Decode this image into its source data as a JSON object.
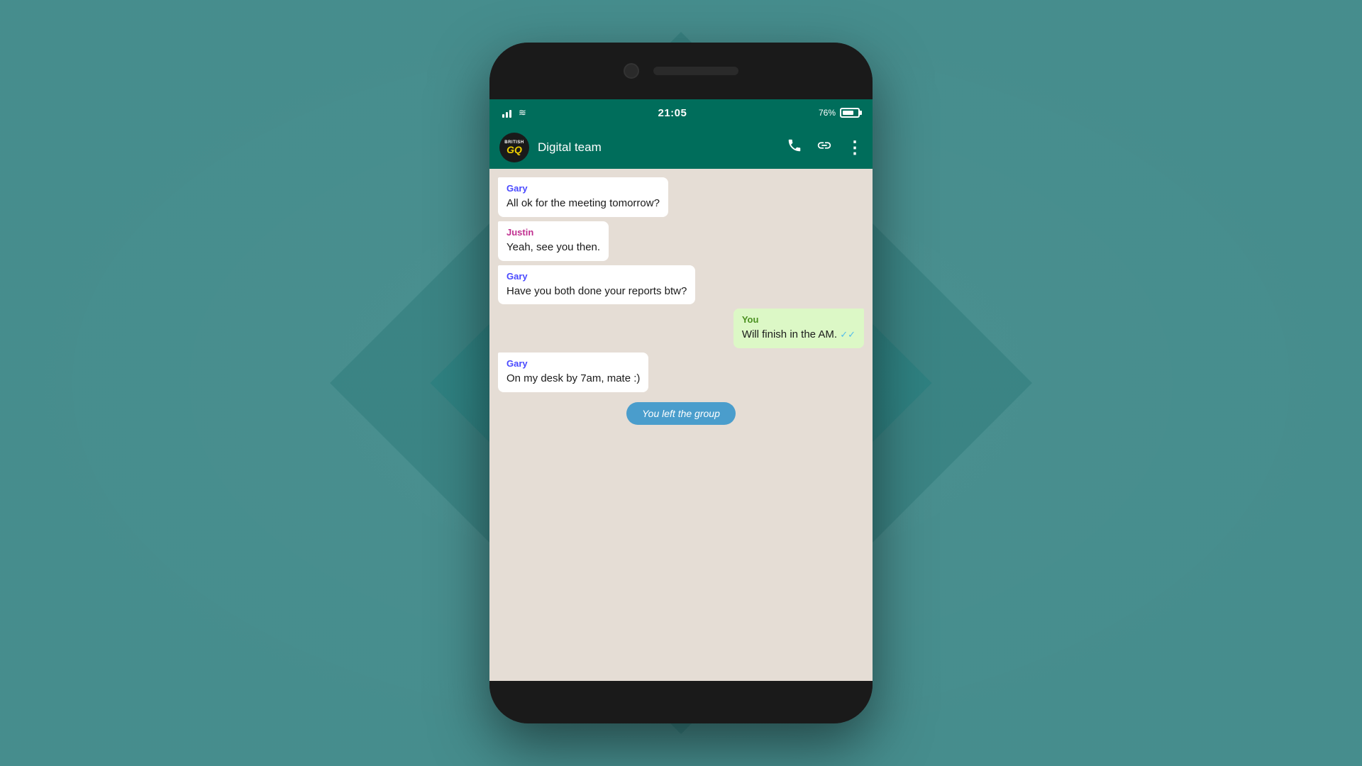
{
  "background": {
    "color": "#4a9a9a"
  },
  "phone": {
    "status_bar": {
      "time": "21:05",
      "battery_percent": "76%",
      "signal_bars": 3,
      "wifi": true
    },
    "chat_header": {
      "group_name": "Digital team",
      "avatar_top": "BRITISH",
      "avatar_bottom": "GQ",
      "call_icon": "📞",
      "link_icon": "🔗",
      "menu_icon": "⋮"
    },
    "messages": [
      {
        "id": "msg1",
        "type": "received",
        "sender": "Gary",
        "sender_class": "sender-gary",
        "text": "All ok for the meeting tomorrow?"
      },
      {
        "id": "msg2",
        "type": "received",
        "sender": "Justin",
        "sender_class": "sender-justin",
        "text": "Yeah, see you then."
      },
      {
        "id": "msg3",
        "type": "received",
        "sender": "Gary",
        "sender_class": "sender-gary",
        "text": "Have you both done your reports btw?"
      },
      {
        "id": "msg4",
        "type": "sent",
        "sender": "You",
        "sender_class": "sender-you",
        "text": "Will finish in the AM.",
        "read": true
      },
      {
        "id": "msg5",
        "type": "received",
        "sender": "Gary",
        "sender_class": "sender-gary",
        "text": "On my desk by 7am, mate :)"
      }
    ],
    "system_message": "You left the group"
  }
}
